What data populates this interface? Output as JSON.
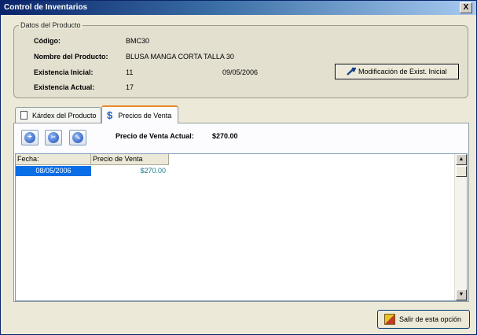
{
  "window": {
    "title": "Control de Inventarios",
    "close_glyph": "X"
  },
  "product": {
    "legend": "Datos del Producto",
    "codigo_label": "Código:",
    "codigo_value": "BMC30",
    "nombre_label": "Nombre del Producto:",
    "nombre_value": "BLUSA MANGA CORTA TALLA 30",
    "exist_inicial_label": "Existencia Inicial:",
    "exist_inicial_value": "11",
    "exist_inicial_date": "09/05/2006",
    "exist_actual_label": "Existencia Actual:",
    "exist_actual_value": "17",
    "modify_button": "Modificación de Exist. Inicial"
  },
  "tabs": [
    {
      "label": "Kárdex del Producto",
      "icon": "document-icon",
      "active": false
    },
    {
      "label": "Precios de Venta",
      "icon": "dollar-icon",
      "active": true
    }
  ],
  "price_panel": {
    "toolbar_icons": [
      "add-icon",
      "delete-icon",
      "edit-icon"
    ],
    "current_price_label": "Precio de Venta Actual:",
    "current_price_value": "$270.00",
    "columns": [
      "Fecha:",
      "Precio de Venta"
    ],
    "rows": [
      {
        "fecha": "08/05/2006",
        "precio": "$270.00"
      }
    ]
  },
  "footer": {
    "exit_button": "Salir de esta opción"
  },
  "colors": {
    "selection": "#0a6ee6",
    "price_text": "#1a7a8c",
    "tab_accent": "#e68b2c"
  }
}
